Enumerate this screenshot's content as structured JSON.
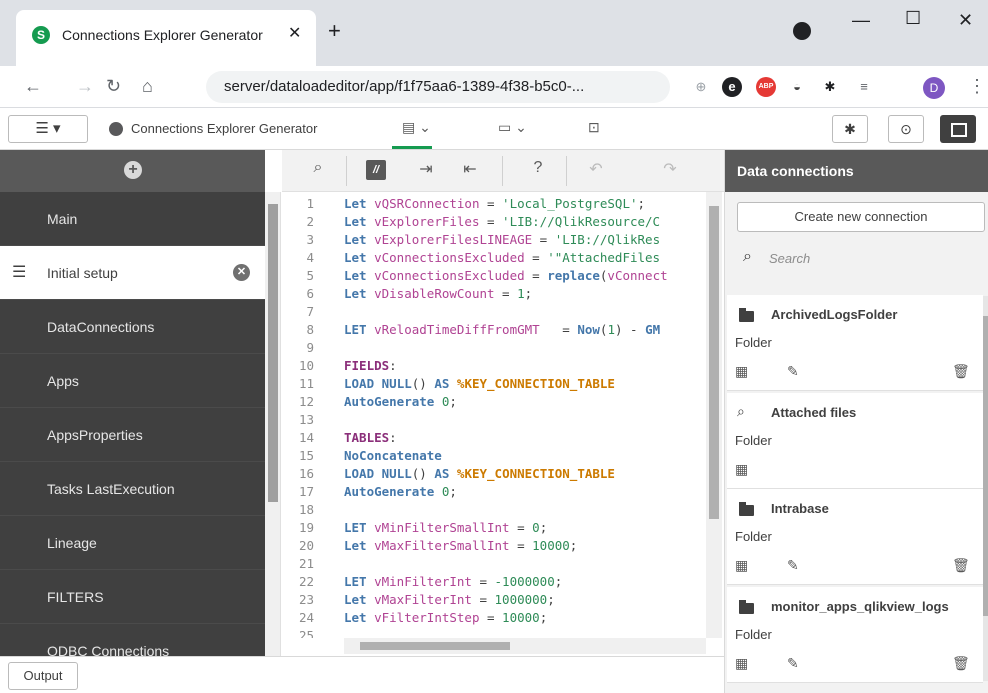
{
  "browser": {
    "tab_title": "Connections Explorer Generator",
    "tab_favicon": "S",
    "close_tab": "✕",
    "new_tab": "+",
    "url": "server/dataloadeditor/app/f1f75aa6-1389-4f38-b5c0-...",
    "profile_initial": "D",
    "ext_abp": "ABP"
  },
  "app": {
    "menu_label": "☰ ▾",
    "name": "Connections Explorer Generator"
  },
  "sidebar": {
    "sections": [
      {
        "label": "Main"
      },
      {
        "label": "Initial setup"
      },
      {
        "label": "DataConnections"
      },
      {
        "label": "Apps"
      },
      {
        "label": "AppsProperties"
      },
      {
        "label": "Tasks LastExecution"
      },
      {
        "label": "Lineage"
      },
      {
        "label": "FILTERS"
      },
      {
        "label": "ODBC Connections"
      }
    ]
  },
  "editor": {
    "lines": [
      "1",
      "2",
      "3",
      "4",
      "5",
      "6",
      "7",
      "8",
      "9",
      "10",
      "11",
      "12",
      "13",
      "14",
      "15",
      "16",
      "17",
      "18",
      "19",
      "20",
      "21",
      "22",
      "23",
      "24",
      "25"
    ]
  },
  "data_connections": {
    "title": "Data connections",
    "create_button": "Create new connection",
    "search_placeholder": "Search",
    "items": [
      {
        "name": "ArchivedLogsFolder",
        "type": "Folder"
      },
      {
        "name": "Attached files",
        "type": "Folder"
      },
      {
        "name": "Intrabase",
        "type": "Folder"
      },
      {
        "name": "monitor_apps_qlikview_logs",
        "type": "Folder"
      }
    ]
  },
  "output": {
    "label": "Output"
  },
  "colors": {
    "accent": "#159b50",
    "sidebar_bg": "#404040",
    "header_bg": "#595959"
  }
}
